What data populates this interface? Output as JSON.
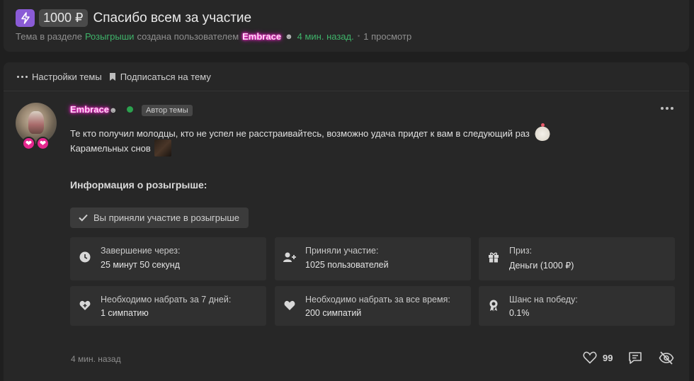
{
  "thread": {
    "price": "1000 ₽",
    "title": "Спасибо всем за участие",
    "meta_prefix": "Тема в разделе",
    "section": "Розыгрыши",
    "meta_created_by": "создана пользователем",
    "author": "Embrace",
    "time_ago": "4 мин. назад.",
    "views": "1 просмотр"
  },
  "toolbar": {
    "settings_label": "Настройки темы",
    "subscribe_label": "Подписаться на тему"
  },
  "post": {
    "author": "Embrace",
    "author_badge": "Автор темы",
    "line1": "Те кто получил молодцы, кто не успел не расстраивайтесь, возможно удача придет к вам в следующий раз",
    "line2": "Карамельных снов",
    "time": "4 мин. назад",
    "likes": "99"
  },
  "giveaway": {
    "title": "Информация о розыгрыше:",
    "participated_label": "Вы приняли участие в розыгрыше",
    "cards": [
      {
        "label": "Завершение через:",
        "value": "25 минут 50 секунд",
        "icon": "clock-icon"
      },
      {
        "label": "Приняли участие:",
        "value": "1025 пользователей",
        "icon": "user-plus-icon"
      },
      {
        "label": "Приз:",
        "value": "Деньги (1000 ₽)",
        "icon": "gift-icon"
      },
      {
        "label": "Необходимо набрать за 7 дней:",
        "value": "1 симпатию",
        "icon": "heart-plus-icon"
      },
      {
        "label": "Необходимо набрать за все время:",
        "value": "200 симпатий",
        "icon": "heart-icon"
      },
      {
        "label": "Шанс на победу:",
        "value": "0.1%",
        "icon": "award-icon"
      }
    ]
  },
  "colors": {
    "background": "#1f1f1f",
    "card": "#272727",
    "info_card": "#303030",
    "accent_green": "#3fb36a",
    "bolt_purple": "#8a5bd6",
    "heart_pink": "#e5278e",
    "author_glow": "#ff2fd0"
  }
}
